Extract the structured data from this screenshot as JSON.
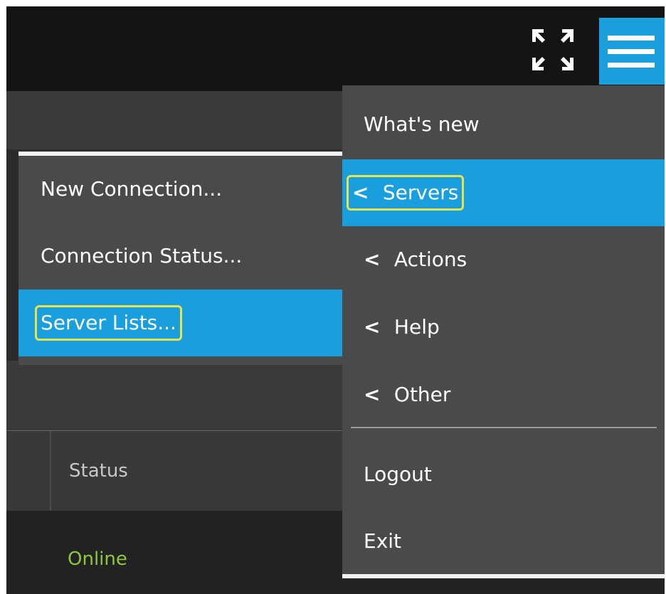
{
  "colors": {
    "accent": "#1a9fde",
    "highlight_outline": "#e8e34a",
    "online_status": "#8ec641",
    "menu_background": "#4a4a4a",
    "topbar_background": "#141414"
  },
  "topbar": {
    "fullscreen_icon": "fullscreen-arrows-icon",
    "menu_icon": "hamburger-menu-icon"
  },
  "main_menu": {
    "whats_new": "What's new",
    "servers": "Servers",
    "actions": "Actions",
    "help": "Help",
    "other": "Other",
    "logout": "Logout",
    "exit": "Exit",
    "submenu_chevron": "<"
  },
  "servers_submenu": {
    "new_connection": "New Connection...",
    "connection_status": "Connection Status...",
    "server_lists": "Server Lists..."
  },
  "table": {
    "status_header": "Status",
    "rows": [
      {
        "status": "Online"
      }
    ]
  }
}
